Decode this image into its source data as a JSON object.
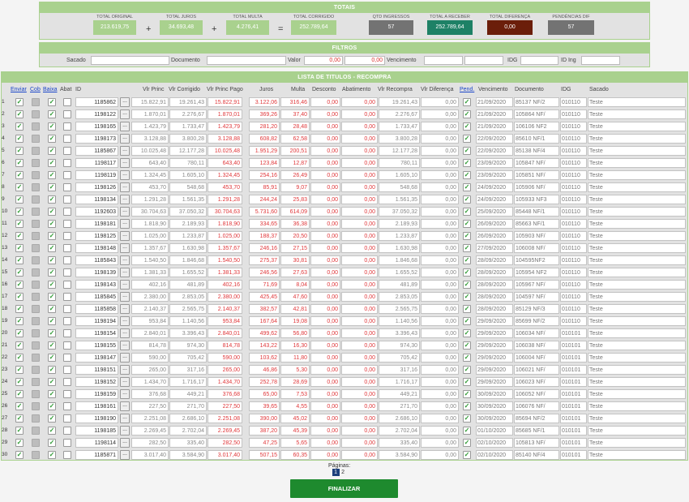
{
  "totais": {
    "title": "TOTAIS",
    "items": [
      {
        "label": "TOTAL ORIGINAL",
        "value": "213.619,75",
        "color": "#a9d18e"
      },
      {
        "label": "TOTAL JUROS",
        "value": "34.693,48",
        "color": "#a9d18e"
      },
      {
        "label": "TOTAL MULTA",
        "value": "4.276,41",
        "color": "#a9d18e"
      },
      {
        "label": "TOTAL CORRIGIDO",
        "value": "252.789,64",
        "color": "#a9d18e"
      },
      {
        "label": "QTD INGRESSOS",
        "value": "57",
        "color": "#737373"
      },
      {
        "label": "TOTAL A RECEBER",
        "value": "252.789,64",
        "color": "#1e8166"
      },
      {
        "label": "TOTAL DIFERENÇA",
        "value": "0,00",
        "color": "#6b1e0a"
      },
      {
        "label": "PENDÊNCIAS DIF",
        "value": "57",
        "color": "#737373"
      }
    ],
    "ops": [
      "+",
      "+",
      "="
    ]
  },
  "filtros": {
    "title": "FILTROS",
    "sacado": "Sacado",
    "documento": "Documento",
    "valor": "Valor",
    "valor_de": "0,00",
    "valor_ate": "0,00",
    "vencimento": "Vencimento",
    "idg": "IDG",
    "id_ing": "ID Ing"
  },
  "lista": {
    "title": "LISTA DE TITULOS - RECOMPRA",
    "headers": {
      "enviar": "Enviar",
      "cob": "Cob",
      "baixa": "Baixa",
      "abat": "Abat",
      "id": "ID",
      "vlr_princ": "Vlr Princ",
      "vlr_corrigido": "Vlr Corrigido",
      "vlr_princ_pago": "Vlr Princ Pago",
      "juros": "Juros",
      "multa": "Multa",
      "desconto": "Desconto",
      "abatimento": "Abatimento",
      "vlr_recompra": "Vlr Recompra",
      "vlr_diferenca": "Vlr Diferença",
      "pend": "Pend.",
      "vencimento": "Vencimento",
      "documento": "Documento",
      "idg": "IDG",
      "sacado": "Sacado"
    },
    "rows": [
      [
        "1",
        "1185862",
        "15.822,91",
        "19.261,43",
        "15.822,91",
        "3.122,06",
        "316,46",
        "0,00",
        "0,00",
        "19.261,43",
        "0,00",
        "21/09/2020",
        "85137 NF/2",
        "010110",
        "Teste"
      ],
      [
        "2",
        "1198122",
        "1.870,01",
        "2.276,67",
        "1.870,01",
        "369,26",
        "37,40",
        "0,00",
        "0,00",
        "2.276,67",
        "0,00",
        "21/09/2020",
        "105864 NF/",
        "010110",
        "Teste"
      ],
      [
        "3",
        "1198165",
        "1.423,79",
        "1.733,47",
        "1.423,79",
        "281,20",
        "28,48",
        "0,00",
        "0,00",
        "1.733,47",
        "0,00",
        "21/09/2020",
        "106106 NF2",
        "010110",
        "Teste"
      ],
      [
        "4",
        "1198173",
        "3.128,88",
        "3.800,28",
        "3.128,88",
        "608,82",
        "62,58",
        "0,00",
        "0,00",
        "3.800,28",
        "0,00",
        "22/09/2020",
        "85610 NF/1",
        "010110",
        "Teste"
      ],
      [
        "5",
        "1185867",
        "10.025,48",
        "12.177,28",
        "10.025,48",
        "1.951,29",
        "200,51",
        "0,00",
        "0,00",
        "12.177,28",
        "0,00",
        "22/09/2020",
        "85138 NF/4",
        "010110",
        "Teste"
      ],
      [
        "6",
        "1198117",
        "643,40",
        "780,11",
        "643,40",
        "123,84",
        "12,87",
        "0,00",
        "0,00",
        "780,11",
        "0,00",
        "23/09/2020",
        "105847 NF/",
        "010110",
        "Teste"
      ],
      [
        "7",
        "1198119",
        "1.324,45",
        "1.605,10",
        "1.324,45",
        "254,16",
        "26,49",
        "0,00",
        "0,00",
        "1.605,10",
        "0,00",
        "23/09/2020",
        "105851 NF/",
        "010110",
        "Teste"
      ],
      [
        "8",
        "1198126",
        "453,70",
        "548,68",
        "453,70",
        "85,91",
        "9,07",
        "0,00",
        "0,00",
        "548,68",
        "0,00",
        "24/09/2020",
        "105906 NF/",
        "010110",
        "Teste"
      ],
      [
        "9",
        "1198134",
        "1.291,28",
        "1.561,35",
        "1.291,28",
        "244,24",
        "25,83",
        "0,00",
        "0,00",
        "1.561,35",
        "0,00",
        "24/09/2020",
        "105933 NF3",
        "010110",
        "Teste"
      ],
      [
        "10",
        "1192603",
        "30.704,63",
        "37.050,32",
        "30.704,63",
        "5.731,60",
        "614,09",
        "0,00",
        "0,00",
        "37.050,32",
        "0,00",
        "25/09/2020",
        "85448 NF/1",
        "010110",
        "Teste"
      ],
      [
        "11",
        "1198181",
        "1.818,90",
        "2.189,93",
        "1.818,90",
        "334,65",
        "36,38",
        "0,00",
        "0,00",
        "2.189,93",
        "0,00",
        "26/09/2020",
        "85663 NF/1",
        "010110",
        "Teste"
      ],
      [
        "12",
        "1198125",
        "1.025,00",
        "1.233,87",
        "1.025,00",
        "188,37",
        "20,50",
        "0,00",
        "0,00",
        "1.233,87",
        "0,00",
        "26/09/2020",
        "105903 NF/",
        "010110",
        "Teste"
      ],
      [
        "13",
        "1198148",
        "1.357,67",
        "1.630,98",
        "1.357,67",
        "246,16",
        "27,15",
        "0,00",
        "0,00",
        "1.630,98",
        "0,00",
        "27/09/2020",
        "106008 NF/",
        "010110",
        "Teste"
      ],
      [
        "14",
        "1185843",
        "1.540,50",
        "1.846,68",
        "1.540,50",
        "275,37",
        "30,81",
        "0,00",
        "0,00",
        "1.846,68",
        "0,00",
        "28/09/2020",
        "104595NF2",
        "010110",
        "Teste"
      ],
      [
        "15",
        "1198139",
        "1.381,33",
        "1.655,52",
        "1.381,33",
        "246,56",
        "27,63",
        "0,00",
        "0,00",
        "1.655,52",
        "0,00",
        "28/09/2020",
        "105954 NF2",
        "010110",
        "Teste"
      ],
      [
        "16",
        "1198143",
        "402,16",
        "481,89",
        "402,16",
        "71,69",
        "8,04",
        "0,00",
        "0,00",
        "481,89",
        "0,00",
        "28/09/2020",
        "105967 NF/",
        "010110",
        "Teste"
      ],
      [
        "17",
        "1185845",
        "2.380,00",
        "2.853,05",
        "2.380,00",
        "425,45",
        "47,60",
        "0,00",
        "0,00",
        "2.853,05",
        "0,00",
        "28/09/2020",
        "104597 NF/",
        "010110",
        "Teste"
      ],
      [
        "18",
        "1185858",
        "2.140,37",
        "2.565,75",
        "2.140,37",
        "382,57",
        "42,81",
        "0,00",
        "0,00",
        "2.565,75",
        "0,00",
        "28/09/2020",
        "85129 NF/3",
        "010110",
        "Teste"
      ],
      [
        "19",
        "1198194",
        "953,84",
        "1.140,56",
        "953,84",
        "167,64",
        "19,08",
        "0,00",
        "0,00",
        "1.140,56",
        "0,00",
        "29/09/2020",
        "85699 NF/2",
        "010110",
        "Teste"
      ],
      [
        "20",
        "1198154",
        "2.840,01",
        "3.396,43",
        "2.840,01",
        "499,62",
        "56,80",
        "0,00",
        "0,00",
        "3.396,43",
        "0,00",
        "29/09/2020",
        "106034 NF/",
        "010101",
        "Teste"
      ],
      [
        "21",
        "1198155",
        "814,78",
        "974,30",
        "814,78",
        "143,22",
        "16,30",
        "0,00",
        "0,00",
        "974,30",
        "0,00",
        "29/09/2020",
        "106038 NF/",
        "010101",
        "Teste"
      ],
      [
        "22",
        "1198147",
        "590,00",
        "705,42",
        "590,00",
        "103,62",
        "11,80",
        "0,00",
        "0,00",
        "705,42",
        "0,00",
        "29/09/2020",
        "106004 NF/",
        "010101",
        "Teste"
      ],
      [
        "23",
        "1198151",
        "265,00",
        "317,16",
        "265,00",
        "46,86",
        "5,30",
        "0,00",
        "0,00",
        "317,16",
        "0,00",
        "29/09/2020",
        "106021 NF/",
        "010101",
        "Teste"
      ],
      [
        "24",
        "1198152",
        "1.434,70",
        "1.716,17",
        "1.434,70",
        "252,78",
        "28,69",
        "0,00",
        "0,00",
        "1.716,17",
        "0,00",
        "29/09/2020",
        "106023 NF/",
        "010101",
        "Teste"
      ],
      [
        "25",
        "1198159",
        "376,68",
        "449,21",
        "376,68",
        "65,00",
        "7,53",
        "0,00",
        "0,00",
        "449,21",
        "0,00",
        "30/09/2020",
        "106052 NF/",
        "010101",
        "Teste"
      ],
      [
        "26",
        "1198161",
        "227,50",
        "271,70",
        "227,50",
        "39,65",
        "4,55",
        "0,00",
        "0,00",
        "271,70",
        "0,00",
        "30/09/2020",
        "106076 NF/",
        "010101",
        "Teste"
      ],
      [
        "27",
        "1198190",
        "2.251,08",
        "2.686,10",
        "2.251,08",
        "390,00",
        "45,02",
        "0,00",
        "0,00",
        "2.686,10",
        "0,00",
        "30/09/2020",
        "85694 NF/2",
        "010101",
        "Teste"
      ],
      [
        "28",
        "1198185",
        "2.269,45",
        "2.702,04",
        "2.269,45",
        "387,20",
        "45,39",
        "0,00",
        "0,00",
        "2.702,04",
        "0,00",
        "01/10/2020",
        "85685 NF/1",
        "010101",
        "Teste"
      ],
      [
        "29",
        "1198114",
        "282,50",
        "335,40",
        "282,50",
        "47,25",
        "5,65",
        "0,00",
        "0,00",
        "335,40",
        "0,00",
        "02/10/2020",
        "105813 NF/",
        "010101",
        "Teste"
      ],
      [
        "30",
        "1185871",
        "3.017,40",
        "3.584,90",
        "3.017,40",
        "507,15",
        "60,35",
        "0,00",
        "0,00",
        "3.584,90",
        "0,00",
        "02/10/2020",
        "85140 NF/4",
        "010101",
        "Teste"
      ]
    ]
  },
  "paginacao": {
    "label": "Páginas:",
    "pages": [
      "1",
      "2"
    ],
    "active": "1"
  },
  "finalizar": "FINALIZAR"
}
